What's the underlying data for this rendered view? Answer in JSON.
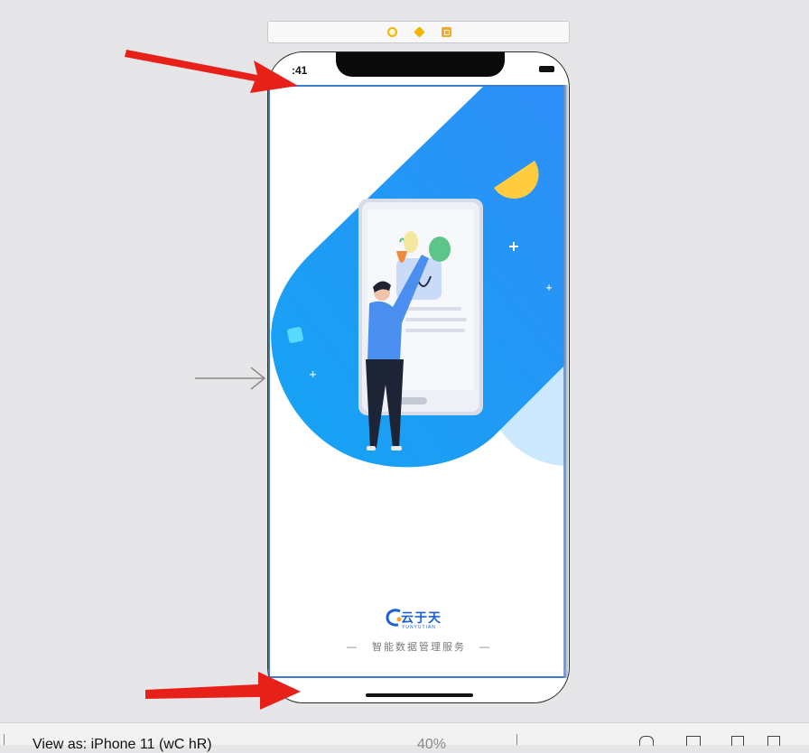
{
  "status_bar": {
    "time": ":41"
  },
  "brand": {
    "logo_name": "云于天",
    "logo_sub": "YUNYUTIAN"
  },
  "splash": {
    "tagline": "智能数据管理服务",
    "dash": "—"
  },
  "bottom_bar": {
    "view_as": "View as: iPhone 11 (wC hR)",
    "zoom": "40%"
  },
  "colors": {
    "accent": "#1f9bf5",
    "selection": "#3d7ad1",
    "arrow": "#e8201a"
  }
}
